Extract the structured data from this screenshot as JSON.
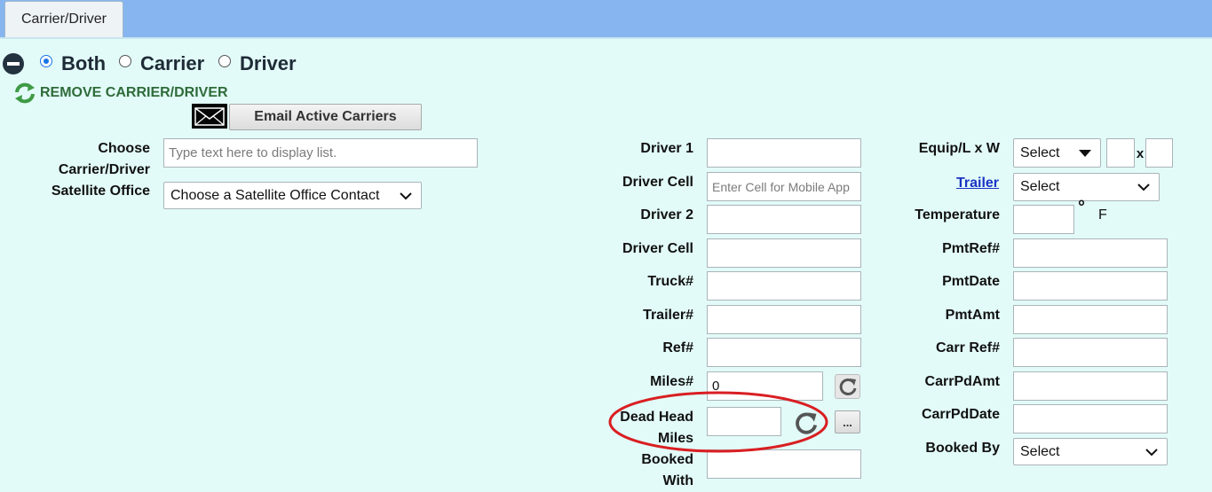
{
  "tabs": [
    {
      "label": "Carrier/Driver"
    }
  ],
  "mode": {
    "options": [
      "Both",
      "Carrier",
      "Driver"
    ],
    "selected": "Both"
  },
  "actions": {
    "remove_label": "REMOVE CARRIER/DRIVER",
    "email_label": "Email Active Carriers"
  },
  "left": {
    "choose_label_1": "Choose",
    "choose_label_2": "Carrier/Driver",
    "choose_placeholder": "Type text here to display list.",
    "satellite_label": "Satellite Office",
    "satellite_value": "Choose a Satellite Office Contact"
  },
  "middle": {
    "driver1_label": "Driver 1",
    "driver1_cell_label": "Driver Cell",
    "driver1_cell_placeholder": "Enter Cell for Mobile App",
    "driver2_label": "Driver 2",
    "driver2_cell_label": "Driver Cell",
    "truck_label": "Truck#",
    "trailer_label": "Trailer#",
    "ref_label": "Ref#",
    "miles_label": "Miles#",
    "miles_value": "0",
    "deadhead_label_1": "Dead Head",
    "deadhead_label_2": "Miles",
    "ellipsis_label": "...",
    "booked_with_1": "Booked",
    "booked_with_2": "With"
  },
  "right": {
    "equip_label": "Equip/L x W",
    "equip_value": "Select",
    "x_label": "x",
    "trailer_link": "Trailer",
    "trailer_value": "Select",
    "temperature_label": "Temperature",
    "degree": "°",
    "unit": "F",
    "pmtref_label": "PmtRef#",
    "pmtdate_label": "PmtDate",
    "pmtamt_label": "PmtAmt",
    "carrref_label": "Carr Ref#",
    "carrpdamt_label": "CarrPdAmt",
    "carrpddate_label": "CarrPdDate",
    "bookedby_label": "Booked By",
    "bookedby_value": "Select"
  },
  "colors": {
    "background": "#e2fbf8",
    "tabbar": "#87b5ef",
    "annotation": "#d91e22",
    "link": "#1a33c4",
    "radio_accent": "#1a73e8"
  },
  "icons": [
    "minus-circle-icon",
    "recycle-icon",
    "envelope-icon",
    "refresh-icon",
    "chevron-down-icon"
  ]
}
